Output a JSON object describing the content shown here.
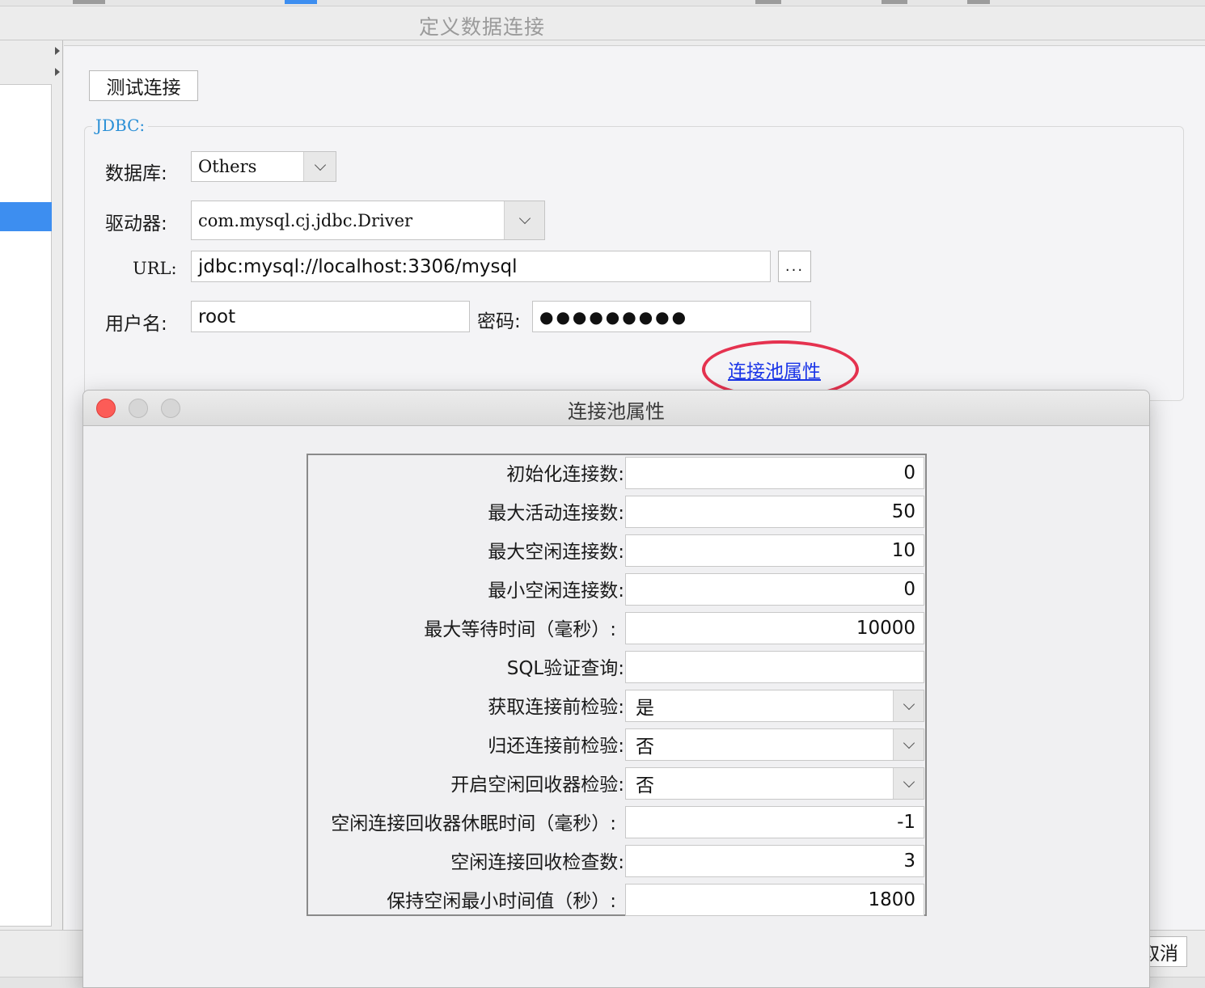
{
  "window": {
    "title": "定义数据连接"
  },
  "toolbar": {
    "test_connection_label": "测试连接"
  },
  "jdbc": {
    "legend": "JDBC:",
    "database_label": "数据库:",
    "database_value": "Others",
    "driver_label": "驱动器:",
    "driver_value": "com.mysql.cj.jdbc.Driver",
    "url_label": "URL:",
    "url_value": "jdbc:mysql://localhost:3306/mysql",
    "url_browse_label": "...",
    "username_label": "用户名:",
    "username_value": "root",
    "password_label": "密码:",
    "password_value": "●●●●●●●●●",
    "pool_link_label": "连接池属性"
  },
  "footer": {
    "cancel_label": "取消"
  },
  "dialog": {
    "title": "连接池属性",
    "rows": [
      {
        "label": "初始化连接数:",
        "value": "0",
        "kind": "number"
      },
      {
        "label": "最大活动连接数:",
        "value": "50",
        "kind": "number"
      },
      {
        "label": "最大空闲连接数:",
        "value": "10",
        "kind": "number"
      },
      {
        "label": "最小空闲连接数:",
        "value": "0",
        "kind": "number"
      },
      {
        "label": "最大等待时间（毫秒）:",
        "value": "10000",
        "kind": "number"
      },
      {
        "label": "SQL验证查询:",
        "value": "",
        "kind": "text"
      },
      {
        "label": "获取连接前检验:",
        "value": "是",
        "kind": "select"
      },
      {
        "label": "归还连接前检验:",
        "value": "否",
        "kind": "select"
      },
      {
        "label": "开启空闲回收器检验:",
        "value": "否",
        "kind": "select"
      },
      {
        "label": "空闲连接回收器休眠时间（毫秒）:",
        "value": "-1",
        "kind": "number"
      },
      {
        "label": "空闲连接回收检查数:",
        "value": "3",
        "kind": "number"
      },
      {
        "label": "保持空闲最小时间值（秒）:",
        "value": "1800",
        "kind": "number"
      }
    ]
  },
  "colors": {
    "accent_link": "#1a35e8",
    "highlight_ring": "#e5324f",
    "legend": "#2a8fd6",
    "selection": "#3d8ef0"
  }
}
